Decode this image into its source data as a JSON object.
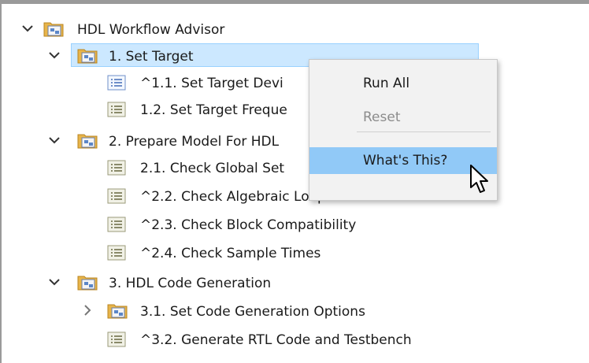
{
  "tree": {
    "root": {
      "label": "HDL Workflow Advisor",
      "icon": "folder-task-icon",
      "expanded": true
    },
    "set_target": {
      "label": "1. Set Target",
      "icon": "folder-task-icon",
      "expanded": true,
      "selected": true
    },
    "set_target_device": {
      "label": "^1.1. Set Target Devi",
      "icon": "task-list-icon"
    },
    "set_target_freq": {
      "label": "1.2. Set Target Freque",
      "icon": "task-list-icon"
    },
    "prepare_model": {
      "label": "2. Prepare Model For HDL",
      "icon": "folder-task-icon",
      "expanded": true
    },
    "check_global": {
      "label": "2.1. Check Global Set",
      "icon": "task-list-icon"
    },
    "check_algebraic": {
      "label": "^2.2. Check Algebraic Loops",
      "icon": "task-list-icon"
    },
    "check_block": {
      "label": "^2.3. Check Block Compatibility",
      "icon": "task-list-icon"
    },
    "check_sample": {
      "label": "^2.4. Check Sample Times",
      "icon": "task-list-icon"
    },
    "hdl_codegen": {
      "label": "3. HDL Code Generation",
      "icon": "folder-task-icon",
      "expanded": true
    },
    "set_codegen_options": {
      "label": "3.1. Set Code Generation Options",
      "icon": "folder-task-icon",
      "expanded": false
    },
    "generate_rtl": {
      "label": "^3.2. Generate RTL Code and Testbench",
      "icon": "task-list-icon"
    }
  },
  "context_menu": {
    "run_all": "Run All",
    "reset": "Reset",
    "whats_this": "What's This?"
  },
  "colors": {
    "selection": "#cce8ff",
    "menu_hover": "#91c9f7",
    "folder": "#e8b54a"
  }
}
